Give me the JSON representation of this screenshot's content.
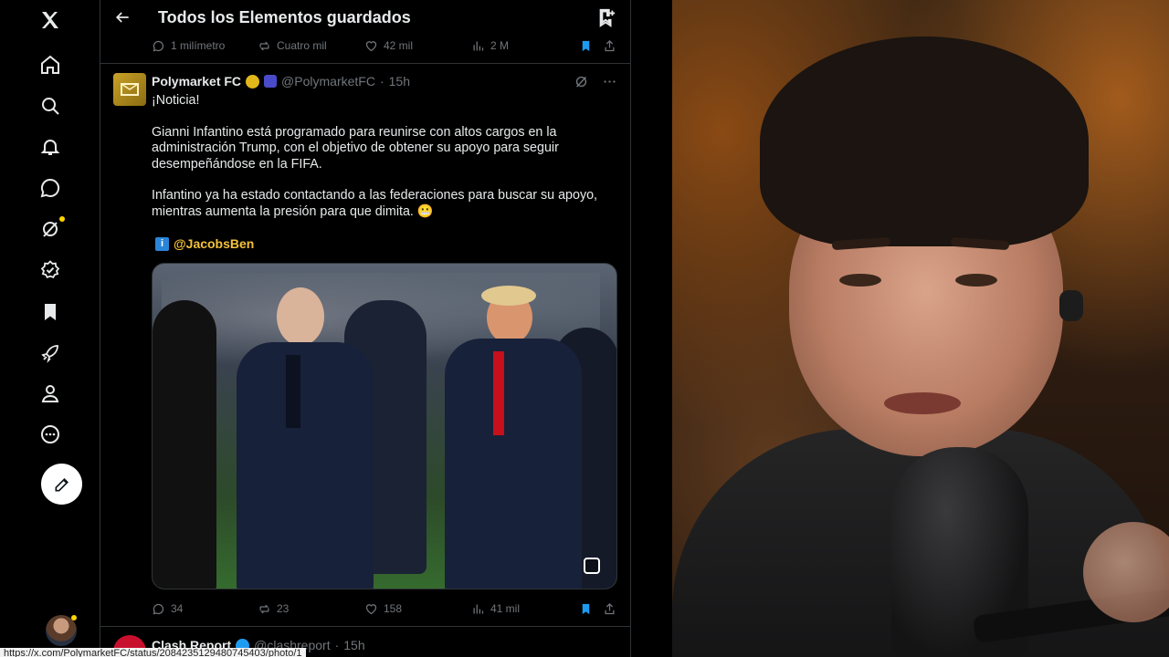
{
  "app": {
    "logo": "x-logo"
  },
  "nav": [
    {
      "name": "home",
      "icon": "home-icon"
    },
    {
      "name": "explore",
      "icon": "search-icon"
    },
    {
      "name": "notifications",
      "icon": "bell-icon"
    },
    {
      "name": "messages",
      "icon": "chat-icon"
    },
    {
      "name": "grok",
      "icon": "grok-icon"
    },
    {
      "name": "verified",
      "icon": "verified-icon"
    },
    {
      "name": "bookmarks",
      "icon": "bookmark-icon"
    },
    {
      "name": "jobs",
      "icon": "rocket-icon"
    },
    {
      "name": "profile",
      "icon": "user-icon"
    },
    {
      "name": "more",
      "icon": "more-icon"
    }
  ],
  "header": {
    "title": "Todos los Elementos guardados"
  },
  "prev_tweet_actions": {
    "replies": "1 milímetro",
    "reposts": "Cuatro mil",
    "likes": "42 mil",
    "views": "2 M"
  },
  "tweet": {
    "author": "Polymarket FC",
    "handle": "@PolymarketFC",
    "time": "15h",
    "line1": "¡Noticia!",
    "para2": "Gianni Infantino está programado para reunirse con altos cargos en la administración Trump, con el objetivo de obtener su apoyo para seguir desempeñándose en la FIFA.",
    "para3": "Infantino ya ha estado contactando a las federaciones para buscar su apoyo, mientras aumenta la presión para que dimita. 😬",
    "mention": "@JacobsBen",
    "actions": {
      "replies": "34",
      "reposts": "23",
      "likes": "158",
      "views": "41 mil"
    }
  },
  "next_tweet": {
    "author": "Clash Report",
    "handle": "@clashreport",
    "time": "15h"
  },
  "status_url": "https://x.com/PolymarketFC/status/2084235129480745403/photo/1",
  "colors": {
    "accent": "#1d9bf0",
    "bookmark_active": "#1d9bf0",
    "gold_badge": "#e2b719"
  }
}
